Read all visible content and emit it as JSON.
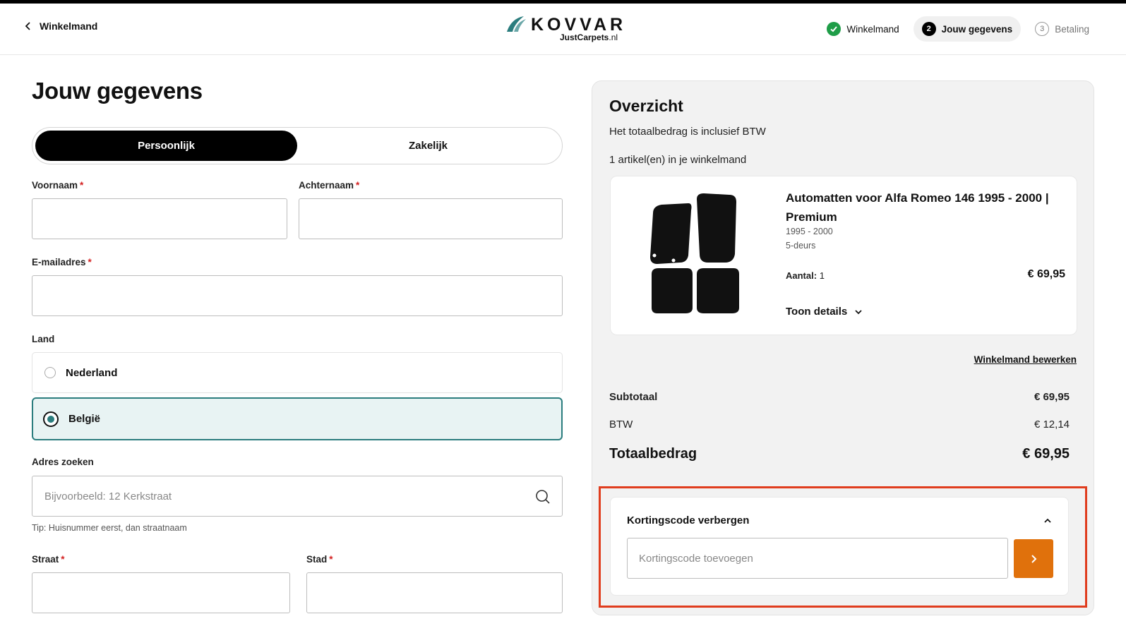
{
  "header": {
    "back_label": "Winkelmand",
    "logo_word": "KOVVAR",
    "logo_sub_bold": "JustCarpets",
    "logo_sub_rest": ".nl",
    "steps": [
      {
        "num": "",
        "label": "Winkelmand",
        "state": "done"
      },
      {
        "num": "2",
        "label": "Jouw gegevens",
        "state": "active"
      },
      {
        "num": "3",
        "label": "Betaling",
        "state": "future"
      }
    ]
  },
  "form": {
    "title": "Jouw gegevens",
    "toggle": [
      "Persoonlijk",
      "Zakelijk"
    ],
    "first_name_label": "Voornaam",
    "last_name_label": "Achternaam",
    "email_label": "E-mailadres",
    "required_mark": "*",
    "country_label": "Land",
    "countries": [
      "Nederland",
      "België"
    ],
    "selected_country": "België",
    "address_label": "Adres zoeken",
    "address_placeholder": "Bijvoorbeeld: 12 Kerkstraat",
    "address_tip": "Tip: Huisnummer eerst, dan straatnaam",
    "street_label": "Straat",
    "city_label": "Stad"
  },
  "overview": {
    "title": "Overzicht",
    "vat_note": "Het totaalbedrag is inclusief BTW",
    "items_count": "1 artikel(en) in je winkelmand",
    "item": {
      "title": "Automatten voor Alfa Romeo 146 1995 - 2000 | Premium",
      "years": "1995 - 2000",
      "doors": "5-deurs",
      "qty_label": "Aantal:",
      "qty": "1",
      "price": "€ 69,95",
      "details_label": "Toon details"
    },
    "edit_cart": "Winkelmand bewerken",
    "subtotal_label": "Subtotaal",
    "subtotal": "€ 69,95",
    "vat_label": "BTW",
    "vat": "€ 12,14",
    "total_label": "Totaalbedrag",
    "total": "€ 69,95",
    "coupon_toggle": "Kortingscode verbergen",
    "coupon_placeholder": "Kortingscode toevoegen"
  },
  "colors": {
    "accent_orange": "#e0710c",
    "highlight_red": "#e03d1e",
    "success_green": "#1f9d48",
    "teal": "#2b7d7e"
  }
}
